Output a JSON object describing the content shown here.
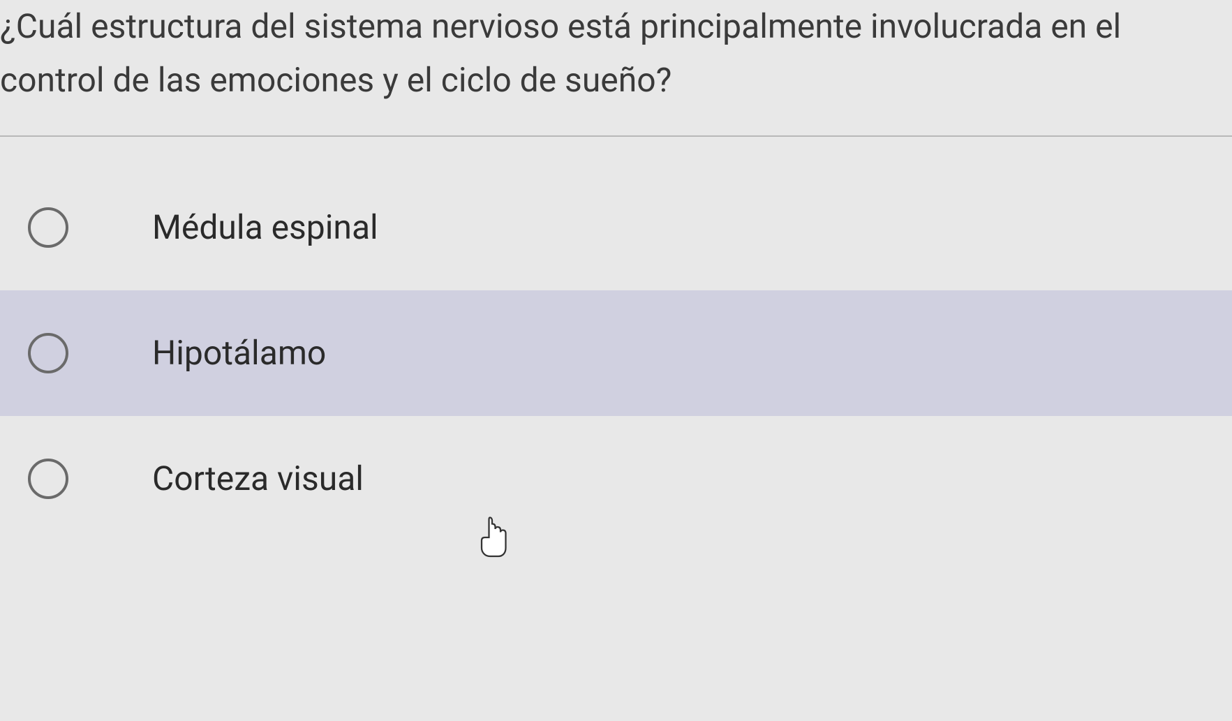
{
  "question": {
    "text": "¿Cuál estructura del sistema nervioso está principalmente involucrada en el control de las emociones y el ciclo de sueño?"
  },
  "options": [
    {
      "label": "Médula espinal",
      "selected": false,
      "hovered": false
    },
    {
      "label": "Hipotálamo",
      "selected": false,
      "hovered": true
    },
    {
      "label": "Corteza visual",
      "selected": false,
      "hovered": false
    }
  ]
}
